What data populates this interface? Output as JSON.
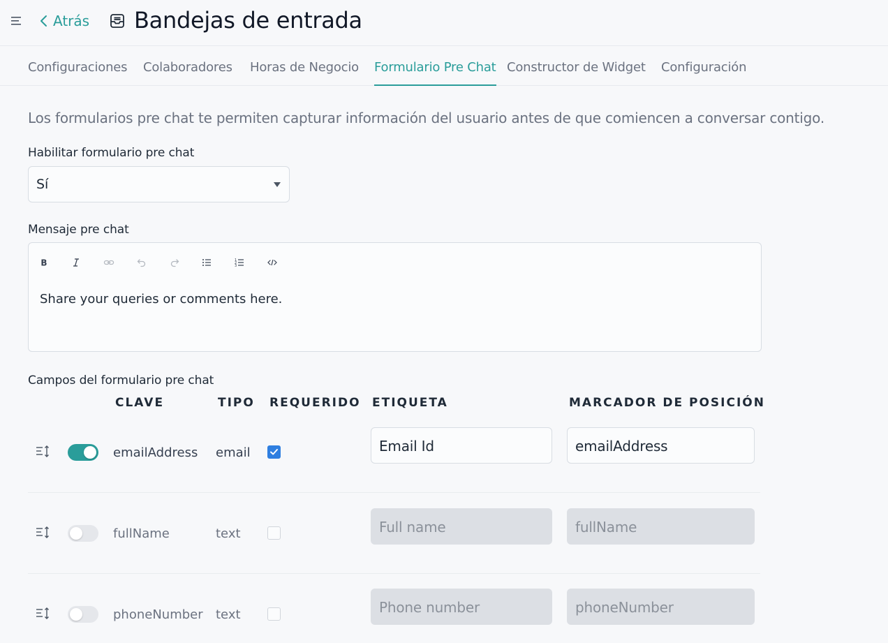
{
  "header": {
    "back_label": "Atrás",
    "title": "Bandejas de entrada",
    "menu_icon": "menu-icon",
    "inbox_icon": "inbox-icon"
  },
  "tabs": [
    {
      "label": "Configuraciones",
      "active": false
    },
    {
      "label": "Colaboradores",
      "active": false
    },
    {
      "label": "Horas de Negocio",
      "active": false
    },
    {
      "label": "Formulario Pre Chat",
      "active": true
    },
    {
      "label": "Constructor de Widget",
      "active": false
    },
    {
      "label": "Configuración",
      "active": false
    }
  ],
  "description": "Los formularios pre chat te permiten capturar información del usuario antes de que comiencen a conversar contigo.",
  "enable": {
    "label": "Habilitar formulario pre chat",
    "value": "Sí"
  },
  "message": {
    "label": "Mensaje pre chat",
    "toolbar": [
      "bold-icon",
      "italic-icon",
      "link-icon",
      "undo-icon",
      "redo-icon",
      "bullet-list-icon",
      "numbered-list-icon",
      "code-icon"
    ],
    "content": "Share your queries or comments here."
  },
  "fields": {
    "label": "Campos del formulario pre chat",
    "columns": {
      "key": "CLAVE",
      "type": "TIPO",
      "required": "REQUERIDO",
      "label": "ETIQUETA",
      "placeholder": "MARCADOR DE POSICIÓN"
    },
    "rows": [
      {
        "key": "emailAddress",
        "type": "email",
        "enabled": true,
        "required": true,
        "label": "Email Id",
        "placeholder": "emailAddress"
      },
      {
        "key": "fullName",
        "type": "text",
        "enabled": false,
        "required": false,
        "label": "Full name",
        "placeholder": "fullName"
      },
      {
        "key": "phoneNumber",
        "type": "text",
        "enabled": false,
        "required": false,
        "label": "Phone number",
        "placeholder": "phoneNumber"
      }
    ]
  },
  "colors": {
    "accent": "#2a9d9a",
    "checkbox": "#2f7fe0",
    "disabled_input": "#dcdfe4"
  }
}
